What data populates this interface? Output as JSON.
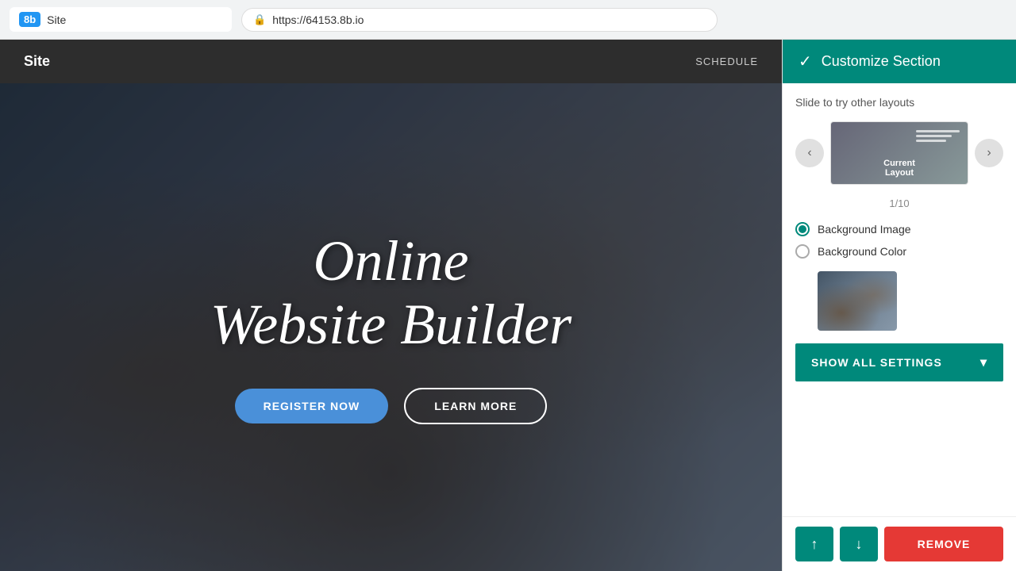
{
  "browser": {
    "logo_text": "8b",
    "site_label": "Site",
    "url": "https://64153.8b.io",
    "lock_icon": "🔒"
  },
  "site_nav": {
    "logo": "Site",
    "nav_link": "SCHEDULE"
  },
  "hero": {
    "title_line1": "Online",
    "title_line2": "Website Builder",
    "register_button": "REGISTER NOW",
    "learn_button": "LEARN MORE"
  },
  "customize_panel": {
    "header_title": "Customize Section",
    "check_icon": "✓",
    "slide_hint": "Slide to try other layouts",
    "layout_label": "Current\nLayout",
    "layout_counter": "1/10",
    "prev_arrow": "‹",
    "next_arrow": "›",
    "background_image_label": "Background Image",
    "background_color_label": "Background Color",
    "show_settings_button": "SHOW ALL SETTINGS",
    "move_up_icon": "↑",
    "move_down_icon": "↓",
    "remove_button": "REMOVE"
  },
  "colors": {
    "teal": "#00897b",
    "red": "#e53935",
    "blue_btn": "#4a90d9"
  }
}
